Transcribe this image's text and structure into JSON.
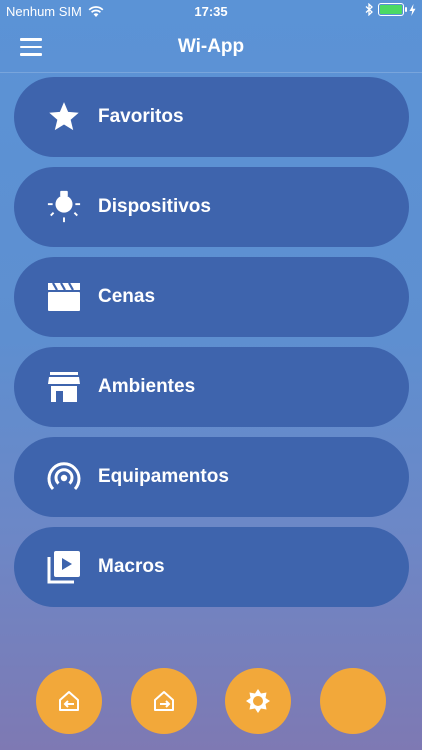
{
  "status": {
    "carrier": "Nenhum SIM",
    "time": "17:35",
    "battery_level": 1.0,
    "battery_color": "#4cd964"
  },
  "header": {
    "title": "Wi-App",
    "menu_icon": "hamburger-icon"
  },
  "menu": {
    "items": [
      {
        "label": "Favoritos",
        "icon": "star-icon"
      },
      {
        "label": "Dispositivos",
        "icon": "lightbulb-icon"
      },
      {
        "label": "Cenas",
        "icon": "clapperboard-icon"
      },
      {
        "label": "Ambientes",
        "icon": "store-icon"
      },
      {
        "label": "Equipamentos",
        "icon": "broadcast-icon"
      },
      {
        "label": "Macros",
        "icon": "playlist-icon"
      }
    ]
  },
  "bottom_actions": [
    {
      "icon": "home-arrive-icon"
    },
    {
      "icon": "home-leave-icon"
    },
    {
      "icon": "sun-icon"
    },
    {
      "icon": "moon-icon"
    }
  ],
  "colors": {
    "item_background": "#3e64ad",
    "action_button": "#f2a83a",
    "background_top": "#5b93d6",
    "background_bottom": "#7e79b3"
  }
}
